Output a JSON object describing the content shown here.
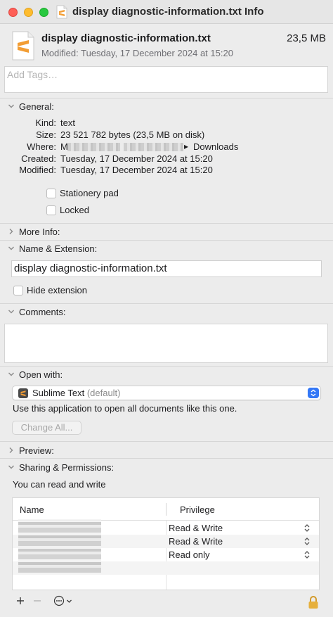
{
  "window": {
    "title": "display diagnostic-information.txt Info"
  },
  "header": {
    "file_name": "display diagnostic-information.txt",
    "file_size": "23,5 MB",
    "modified": "Modified: Tuesday, 17 December 2024 at 15:20"
  },
  "tags": {
    "placeholder": "Add Tags…"
  },
  "general": {
    "label": "General:",
    "kind_label": "Kind:",
    "kind_value": "text",
    "size_label": "Size:",
    "size_value": "23 521 782 bytes (23,5 MB on disk)",
    "where_label": "Where:",
    "where_value_prefix": "M",
    "where_value_suffix": "Downloads",
    "created_label": "Created:",
    "created_value": "Tuesday, 17 December 2024 at 15:20",
    "modified_label": "Modified:",
    "modified_value": "Tuesday, 17 December 2024 at 15:20",
    "stationery_label": "Stationery pad",
    "locked_label": "Locked"
  },
  "more_info": {
    "label": "More Info:"
  },
  "name_extension": {
    "label": "Name & Extension:",
    "value": "display diagnostic-information.txt",
    "hide_extension_label": "Hide extension"
  },
  "comments": {
    "label": "Comments:"
  },
  "open_with": {
    "label": "Open with:",
    "app_name": "Sublime Text",
    "app_suffix": "(default)",
    "description": "Use this application to open all documents like this one.",
    "change_all_label": "Change All..."
  },
  "preview": {
    "label": "Preview:"
  },
  "sharing": {
    "label": "Sharing & Permissions:",
    "summary": "You can read and write",
    "col_name": "Name",
    "col_privilege": "Privilege",
    "rows": [
      {
        "privilege": "Read & Write"
      },
      {
        "privilege": "Read & Write"
      },
      {
        "privilege": "Read only"
      }
    ]
  },
  "colors": {
    "accent": "#3478f6",
    "sublime_orange": "#f29d34"
  }
}
